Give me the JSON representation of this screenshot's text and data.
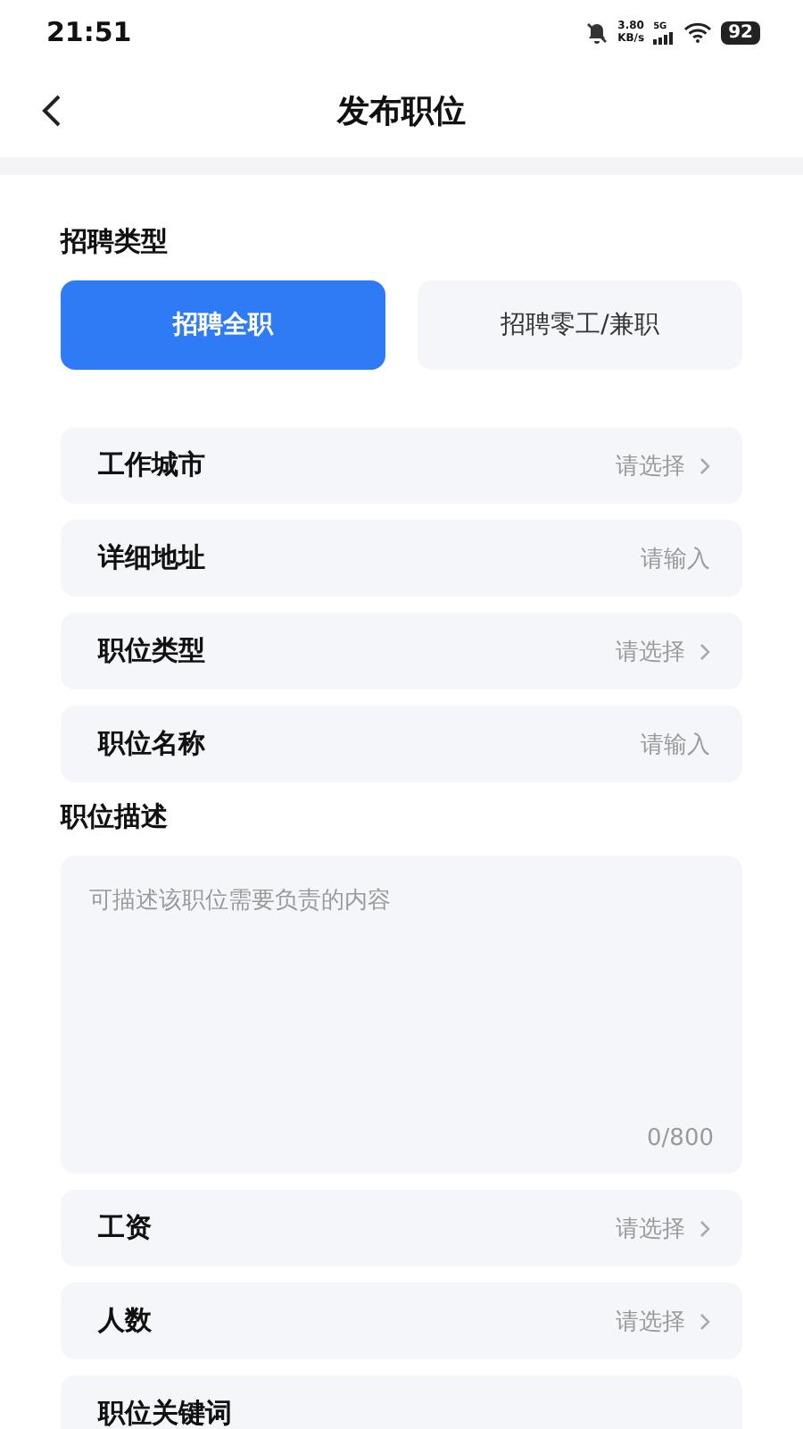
{
  "status_bar": {
    "time": "21:51",
    "speed_value": "3.80",
    "speed_unit": "KB/s",
    "network": "5G",
    "battery": "92"
  },
  "header": {
    "title": "发布职位"
  },
  "recruit_type": {
    "label": "招聘类型",
    "options": [
      {
        "label": "招聘全职",
        "selected": true
      },
      {
        "label": "招聘零工/兼职",
        "selected": false
      }
    ]
  },
  "fields_top": [
    {
      "label": "工作城市",
      "kind": "select",
      "placeholder": "请选择"
    },
    {
      "label": "详细地址",
      "kind": "input",
      "placeholder": "请输入"
    },
    {
      "label": "职位类型",
      "kind": "select",
      "placeholder": "请选择"
    },
    {
      "label": "职位名称",
      "kind": "input",
      "placeholder": "请输入"
    }
  ],
  "description": {
    "label": "职位描述",
    "placeholder": "可描述该职位需要负责的内容",
    "counter": "0/800"
  },
  "fields_bottom": [
    {
      "label": "工资",
      "kind": "select",
      "placeholder": "请选择"
    },
    {
      "label": "人数",
      "kind": "select",
      "placeholder": "请选择"
    },
    {
      "label": "职位关键词",
      "kind": "partial"
    }
  ]
}
